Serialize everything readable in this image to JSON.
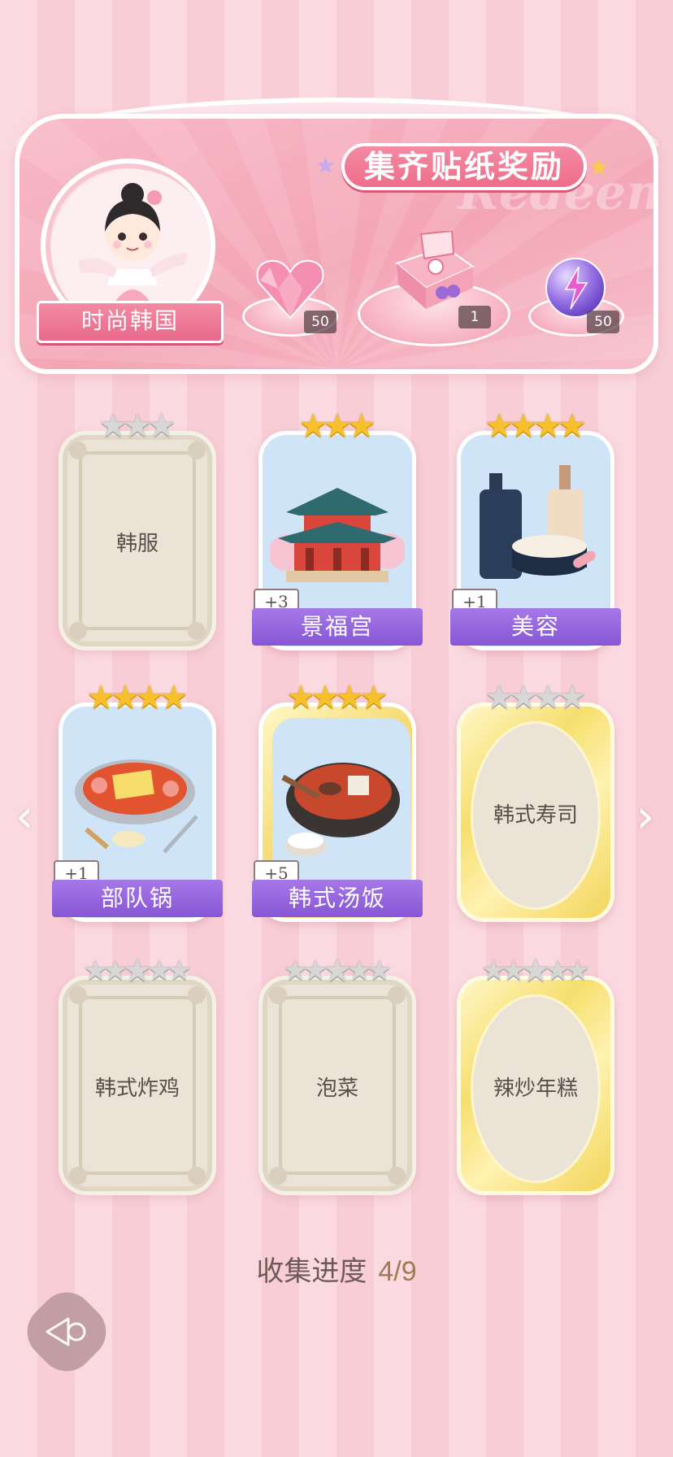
{
  "header": {
    "title": "集齐贴纸奖励",
    "watermark": "Redeem",
    "collection_name": "时尚韩国",
    "rewards": [
      {
        "icon": "pink-heart-gem-icon",
        "count": "50"
      },
      {
        "icon": "gift-box-icon",
        "count": "1"
      },
      {
        "icon": "lightning-orb-icon",
        "count": "50"
      }
    ]
  },
  "cards": [
    {
      "name": "韩服",
      "state": "locked",
      "stars": {
        "gold": 0,
        "silver": 3
      }
    },
    {
      "name": "景福宫",
      "state": "unlocked",
      "bonus": "+3",
      "stars": {
        "gold": 3,
        "silver": 0
      }
    },
    {
      "name": "美容",
      "state": "unlocked",
      "bonus": "+1",
      "stars": {
        "gold": 4,
        "silver": 0
      }
    },
    {
      "name": "部队锅",
      "state": "unlocked",
      "bonus": "+1",
      "stars": {
        "gold": 4,
        "silver": 0
      }
    },
    {
      "name": "韩式汤饭",
      "state": "unlocked",
      "bonus": "+5",
      "stars": {
        "gold": 4,
        "silver": 0
      }
    },
    {
      "name": "韩式寿司",
      "state": "locked-gold",
      "stars": {
        "gold": 0,
        "silver": 4
      }
    },
    {
      "name": "韩式炸鸡",
      "state": "locked",
      "stars": {
        "gold": 0,
        "silver": 5
      }
    },
    {
      "name": "泡菜",
      "state": "locked",
      "stars": {
        "gold": 0,
        "silver": 5
      }
    },
    {
      "name": "辣炒年糕",
      "state": "locked-gold",
      "stars": {
        "gold": 0,
        "silver": 5
      }
    }
  ],
  "progress": {
    "label": "收集进度",
    "value": "4/9",
    "collected": 4,
    "total": 9
  },
  "nav": {
    "prev_icon": "chevron-left-icon",
    "next_icon": "chevron-right-icon",
    "back_icon": "back-arrow-icon"
  },
  "colors": {
    "banner_purple": "#8756d6",
    "title_pink": "#ee6d8a",
    "star_gold": "#f6c12c",
    "star_silver": "#d7d7d7"
  }
}
